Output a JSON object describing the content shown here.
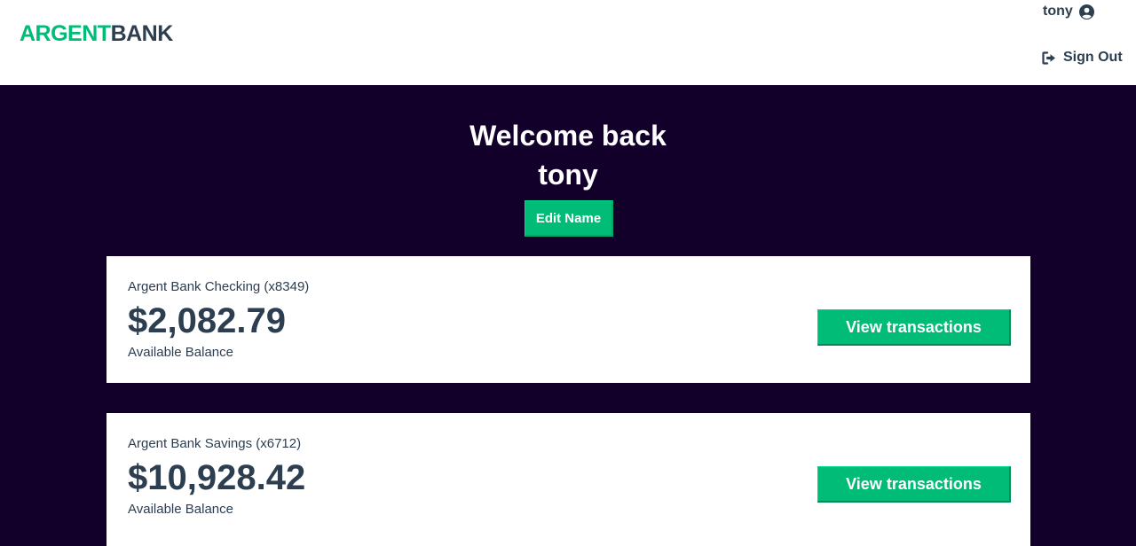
{
  "brand": {
    "part1": "ARGENT",
    "part2": "BANK",
    "color_primary": "#00bc77",
    "color_secondary": "#2c3e50"
  },
  "nav": {
    "username": "tony",
    "user_icon": "user-circle-icon",
    "signout_label": "Sign Out",
    "signout_icon": "sign-out-icon"
  },
  "header": {
    "welcome_line1": "Welcome back",
    "welcome_line2": "tony",
    "edit_button_label": "Edit Name"
  },
  "accounts": [
    {
      "title": "Argent Bank Checking (x8349)",
      "amount": "$2,082.79",
      "description": "Available Balance",
      "button_label": "View transactions"
    },
    {
      "title": "Argent Bank Savings (x6712)",
      "amount": "$10,928.42",
      "description": "Available Balance",
      "button_label": "View transactions"
    }
  ],
  "colors": {
    "background": "#12002b",
    "accent": "#00bc77",
    "text": "#2c3e50"
  }
}
